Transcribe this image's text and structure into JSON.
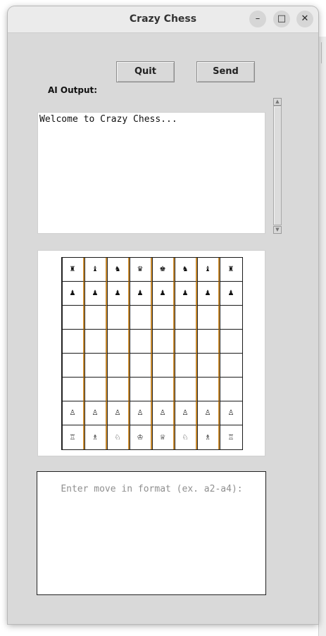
{
  "window": {
    "title": "Crazy Chess",
    "controls": {
      "minimize": "–",
      "maximize": "□",
      "close": "✕"
    }
  },
  "toolbar": {
    "quit_label": "Quit",
    "send_label": "Send"
  },
  "output": {
    "label": "AI Output:",
    "text": "Welcome to Crazy Chess..."
  },
  "scrollbar": {
    "up_arrow": "▲",
    "down_arrow": "▼"
  },
  "board": {
    "rows": [
      [
        "♜",
        "♝",
        "♞",
        "♛",
        "♚",
        "♞",
        "♝",
        "♜"
      ],
      [
        "♟",
        "♟",
        "♟",
        "♟",
        "♟",
        "♟",
        "♟",
        "♟"
      ],
      [
        "",
        "",
        "",
        "",
        "",
        "",
        "",
        ""
      ],
      [
        "",
        "",
        "",
        "",
        "",
        "",
        "",
        ""
      ],
      [
        "",
        "",
        "",
        "",
        "",
        "",
        "",
        ""
      ],
      [
        "",
        "",
        "",
        "",
        "",
        "",
        "",
        ""
      ],
      [
        "♙",
        "♙",
        "♙",
        "♙",
        "♙",
        "♙",
        "♙",
        "♙"
      ],
      [
        "♖",
        "♗",
        "♘",
        "♔",
        "♕",
        "♘",
        "♗",
        "♖"
      ]
    ]
  },
  "move_input": {
    "placeholder": "Enter move in format (ex. a2-a4):"
  },
  "colors": {
    "window_bg": "#d9d9d9",
    "grid_accent": "#c88a2e"
  }
}
